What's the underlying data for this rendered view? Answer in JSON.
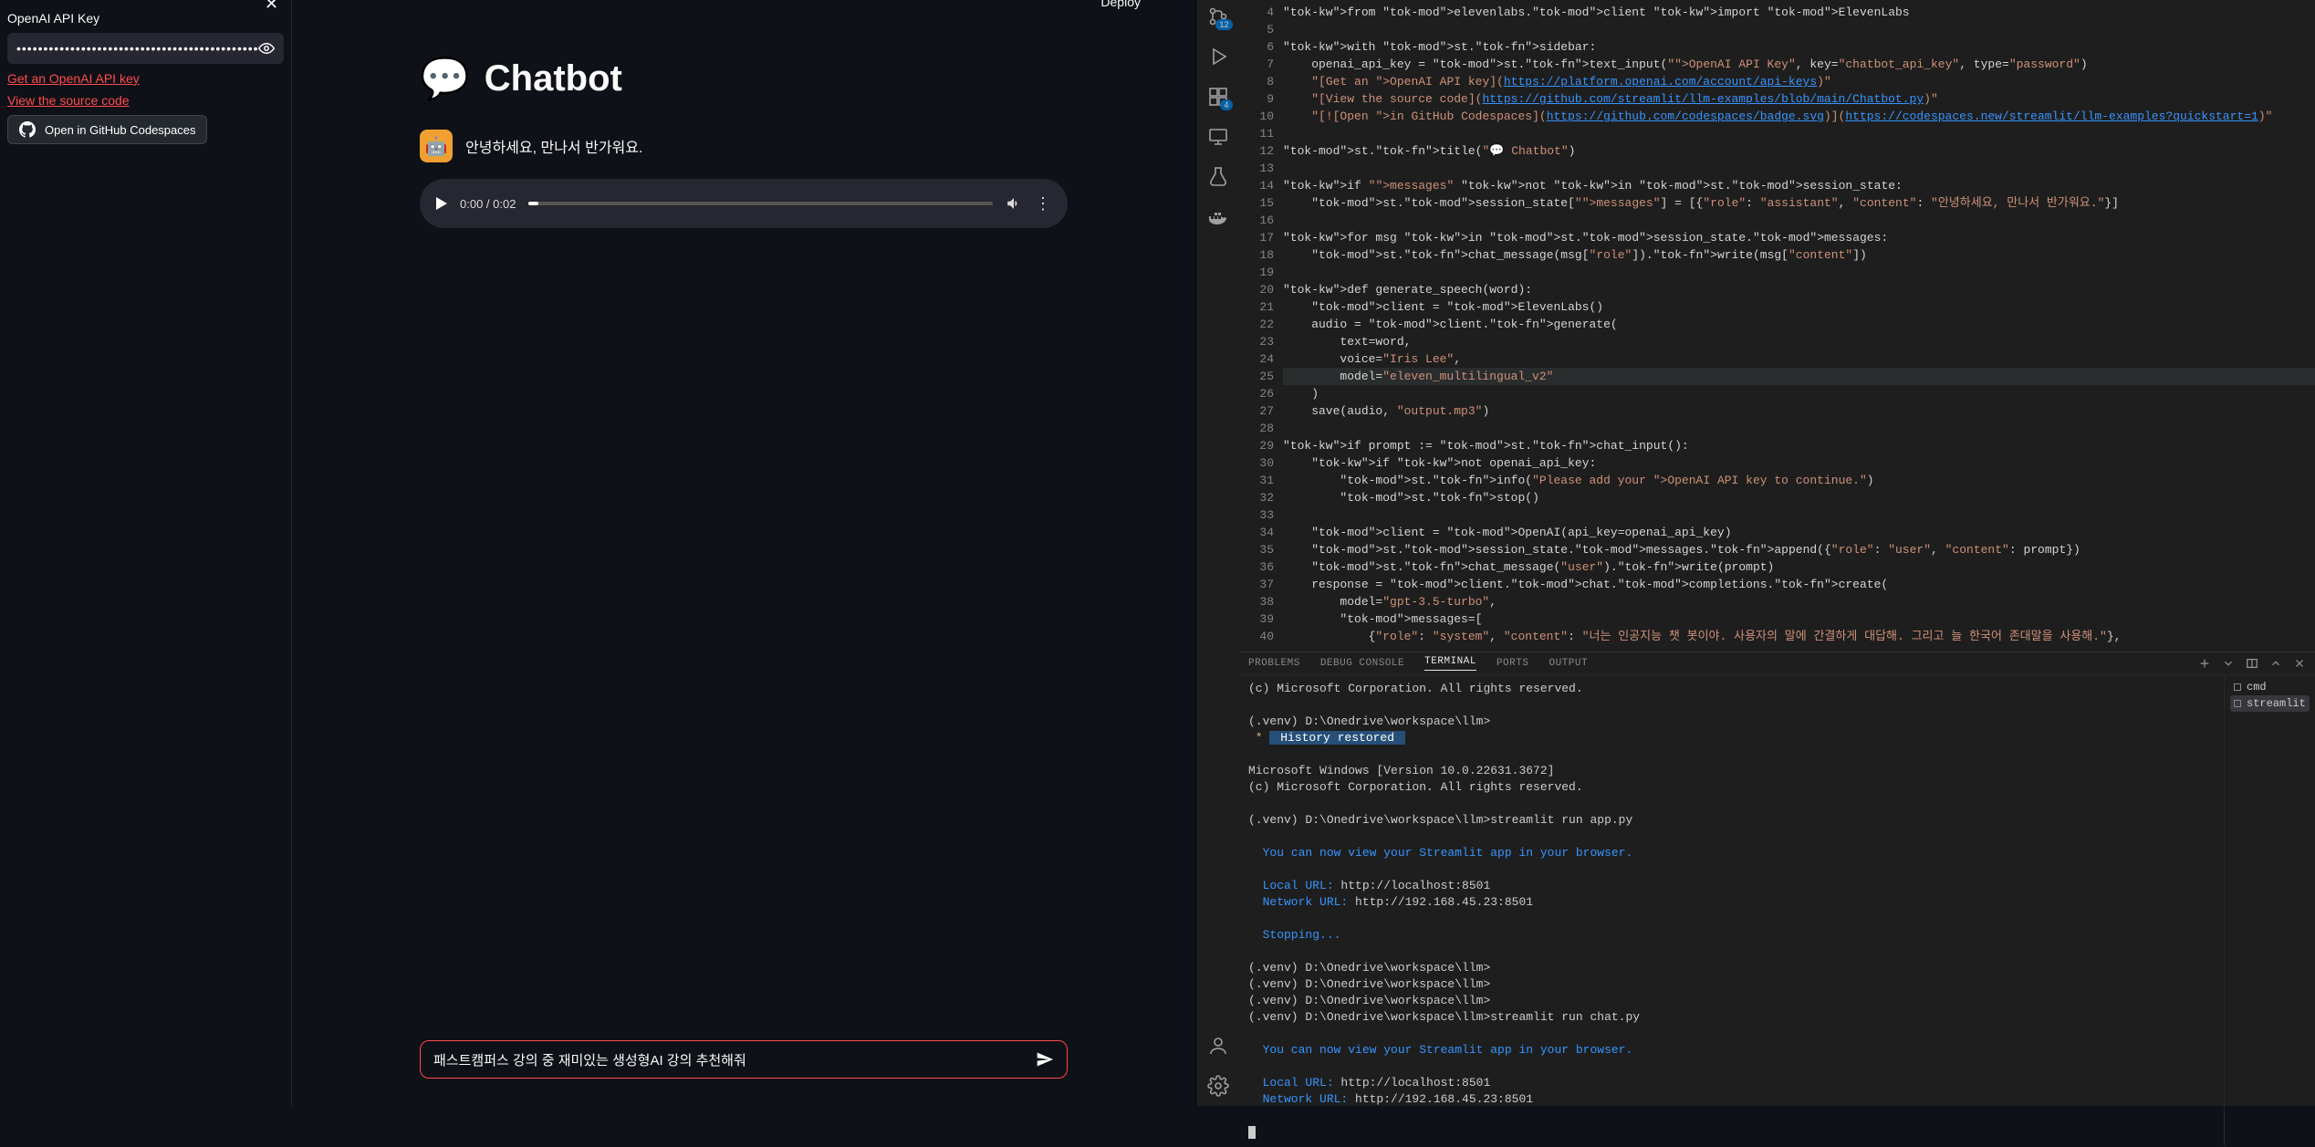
{
  "streamlit": {
    "sidebar": {
      "api_key_label": "OpenAI API Key",
      "api_key_value": "••••••••••••••••••••••••••••••••••••••••••••••••",
      "get_key_link": "Get an OpenAI API key",
      "source_link": "View the source code",
      "codespaces_btn": "Open in GitHub Codespaces"
    },
    "header": {
      "deploy": "Deploy"
    },
    "main": {
      "title": "Chatbot",
      "greeting": "안녕하세요, 만나서 반가워요.",
      "audio": {
        "current": "0:00",
        "total": "0:02"
      },
      "input_value": "패스트캠퍼스 강의 중 재미있는 생성형AI 강의 추천해줘"
    }
  },
  "vscode": {
    "activity": {
      "source_badge": "12",
      "ext_badge": "4"
    },
    "code": {
      "first_line": 4,
      "lines": [
        "from elevenlabs.client import ElevenLabs",
        "",
        "with st.sidebar:",
        "    openai_api_key = st.text_input(\"OpenAI API Key\", key=\"chatbot_api_key\", type=\"password\")",
        "    \"[Get an OpenAI API key](https://platform.openai.com/account/api-keys)\"",
        "    \"[View the source code](https://github.com/streamlit/llm-examples/blob/main/Chatbot.py)\"",
        "    \"[![Open in GitHub Codespaces](https://github.com/codespaces/badge.svg)](https://codespaces.new/streamlit/llm-examples?quickstart=1)\"",
        "",
        "st.title(\"💬 Chatbot\")",
        "",
        "if \"messages\" not in st.session_state:",
        "    st.session_state[\"messages\"] = [{\"role\": \"assistant\", \"content\": \"안녕하세요, 만나서 반가워요.\"}]",
        "",
        "for msg in st.session_state.messages:",
        "    st.chat_message(msg[\"role\"]).write(msg[\"content\"])",
        "",
        "def generate_speech(word):",
        "    client = ElevenLabs()",
        "    audio = client.generate(",
        "        text=word,",
        "        voice=\"Iris Lee\",",
        "        model=\"eleven_multilingual_v2\"",
        "    )",
        "    save(audio, \"output.mp3\")",
        "",
        "if prompt := st.chat_input():",
        "    if not openai_api_key:",
        "        st.info(\"Please add your OpenAI API key to continue.\")",
        "        st.stop()",
        "",
        "    client = OpenAI(api_key=openai_api_key)",
        "    st.session_state.messages.append({\"role\": \"user\", \"content\": prompt})",
        "    st.chat_message(\"user\").write(prompt)",
        "    response = client.chat.completions.create(",
        "        model=\"gpt-3.5-turbo\",",
        "        messages=[",
        "            {\"role\": \"system\", \"content\": \"너는 인공지능 챗 봇이야. 사용자의 말에 간결하게 대답해. 그리고 늘 한국어 존대말을 사용해.\"},"
      ],
      "current_line": 25
    },
    "panel": {
      "tabs": [
        "PROBLEMS",
        "DEBUG CONSOLE",
        "TERMINAL",
        "PORTS",
        "OUTPUT"
      ],
      "active_tab": "TERMINAL",
      "terminals": [
        "cmd",
        "streamlit"
      ],
      "selected_terminal": "streamlit",
      "lines": [
        {
          "t": "(c) Microsoft Corporation. All rights reserved."
        },
        {
          "t": ""
        },
        {
          "t": "(.venv) D:\\Onedrive\\workspace\\llm>"
        },
        {
          "hist": " * ",
          "histlabel": " History restored "
        },
        {
          "t": ""
        },
        {
          "t": "Microsoft Windows [Version 10.0.22631.3672]"
        },
        {
          "t": "(c) Microsoft Corporation. All rights reserved."
        },
        {
          "t": ""
        },
        {
          "t": "(.venv) D:\\Onedrive\\workspace\\llm>streamlit run app.py"
        },
        {
          "t": ""
        },
        {
          "blue": "  You can now view your Streamlit app in your browser."
        },
        {
          "t": ""
        },
        {
          "lbl": "  Local URL:",
          "url": " http://localhost:8501"
        },
        {
          "lbl": "  Network URL:",
          "url": " http://192.168.45.23:8501"
        },
        {
          "t": ""
        },
        {
          "blue": "  Stopping..."
        },
        {
          "t": ""
        },
        {
          "t": "(.venv) D:\\Onedrive\\workspace\\llm>"
        },
        {
          "t": "(.venv) D:\\Onedrive\\workspace\\llm>"
        },
        {
          "t": "(.venv) D:\\Onedrive\\workspace\\llm>"
        },
        {
          "t": "(.venv) D:\\Onedrive\\workspace\\llm>streamlit run chat.py"
        },
        {
          "t": ""
        },
        {
          "blue": "  You can now view your Streamlit app in your browser."
        },
        {
          "t": ""
        },
        {
          "lbl": "  Local URL:",
          "url": " http://localhost:8501"
        },
        {
          "lbl": "  Network URL:",
          "url": " http://192.168.45.23:8501"
        },
        {
          "t": ""
        },
        {
          "cursor": true
        }
      ]
    }
  }
}
